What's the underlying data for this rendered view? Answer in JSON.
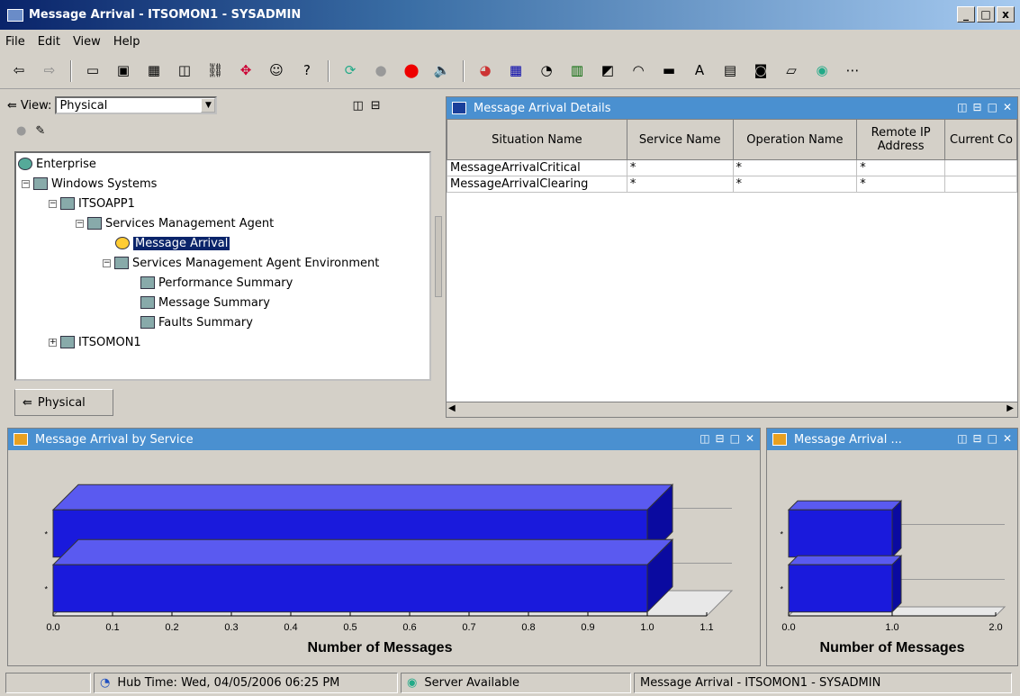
{
  "window": {
    "title": "Message Arrival - ITSOMON1 - SYSADMIN",
    "minimize": "_",
    "maximize": "□",
    "close": "x"
  },
  "menu": [
    "File",
    "Edit",
    "View",
    "Help"
  ],
  "navigator": {
    "view_label": "View:",
    "view_value": "Physical",
    "tab_label": "Physical",
    "tree": {
      "enterprise": "Enterprise",
      "windows": "Windows Systems",
      "itsoapp1": "ITSOAPP1",
      "sma": "Services Management Agent",
      "message_arrival": "Message Arrival",
      "sma_env": "Services Management Agent Environment",
      "perf": "Performance Summary",
      "msg_summary": "Message Summary",
      "faults": "Faults Summary",
      "itsomon1": "ITSOMON1"
    }
  },
  "details": {
    "title": "Message Arrival Details",
    "columns": [
      "Situation Name",
      "Service Name",
      "Operation Name",
      "Remote IP Address",
      "Current Co"
    ],
    "rows": [
      [
        "MessageArrivalCritical",
        "*",
        "*",
        "*",
        ""
      ],
      [
        "MessageArrivalClearing",
        "*",
        "*",
        "*",
        ""
      ]
    ]
  },
  "chart1_title": "Message Arrival by Service",
  "chart2_title": "Message Arrival ...",
  "chart_data": [
    {
      "type": "bar",
      "orientation": "horizontal",
      "categories": [
        "*",
        "*"
      ],
      "values": [
        1.0,
        1.0
      ],
      "xlabel": "Number of Messages",
      "xlim": [
        0.0,
        1.1
      ],
      "xticks": [
        "0.0",
        "0.1",
        "0.2",
        "0.3",
        "0.4",
        "0.5",
        "0.6",
        "0.7",
        "0.8",
        "0.9",
        "1.0",
        "1.1"
      ],
      "color": "#1a1adc"
    },
    {
      "type": "bar",
      "orientation": "horizontal",
      "categories": [
        "*",
        "*"
      ],
      "values": [
        1.0,
        1.0
      ],
      "xlabel": "Number of Messages",
      "xlim": [
        0.0,
        2.0
      ],
      "xticks": [
        "0.0",
        "1.0",
        "2.0"
      ],
      "color": "#1a1adc"
    }
  ],
  "status": {
    "hub_time": "Hub Time: Wed, 04/05/2006 06:25 PM",
    "server": "Server Available",
    "window": "Message Arrival - ITSOMON1 - SYSADMIN"
  }
}
